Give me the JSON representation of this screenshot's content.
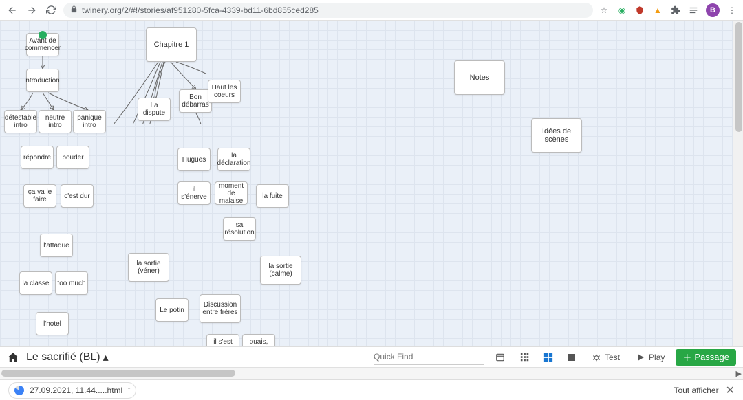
{
  "chrome": {
    "url": "twinery.org/2/#!/stories/af951280-5fca-4339-bd11-6bd855ced285",
    "avatar_letter": "B"
  },
  "passages": {
    "avant": "Avant de commencer",
    "intro": "ntroduction",
    "det": "détestable intro",
    "neutre": "neutre intro",
    "panique": "panique intro",
    "repondre": "répondre",
    "bouder": "bouder",
    "cava": "ça va le faire",
    "cdur": "c'est dur",
    "attaque": "l'attaque",
    "classe": "la classe",
    "toomuch": "too much",
    "hotel": "l'hotel",
    "chap1": "Chapitre 1",
    "dispute": "La dispute",
    "bond": "Bon débarras",
    "haut": "Haut les coeurs",
    "hugues": "Hugues",
    "declar": "la déclaration",
    "enerve": "il s'énerve",
    "malaise": "moment de malaise",
    "fuite": "la fuite",
    "resol": "sa résolution",
    "svener": "la sortie (véner)",
    "scalme": "la sortie (calme)",
    "potin": "Le potin",
    "disc": "Discussion entre frères",
    "rien": "il s'est rien",
    "ouais": "ouais, crois que",
    "notes": "Notes",
    "idees": "Idées de scènes"
  },
  "toolbar": {
    "story_title": "Le sacrifié (BL)",
    "quickfind_placeholder": "Quick Find",
    "test_label": "Test",
    "play_label": "Play",
    "passage_label": "Passage"
  },
  "download": {
    "filename": "27.09.2021, 11.44.....html",
    "show_all": "Tout afficher"
  }
}
